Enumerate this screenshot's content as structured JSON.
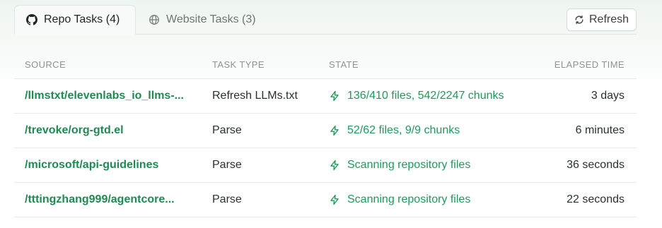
{
  "tabs": [
    {
      "label": "Repo Tasks (4)",
      "icon": "github-icon",
      "active": true
    },
    {
      "label": "Website Tasks (3)",
      "icon": "globe-icon",
      "active": false
    }
  ],
  "refresh": {
    "label": "Refresh",
    "icon": "refresh-icon"
  },
  "table": {
    "headers": {
      "source": "SOURCE",
      "task_type": "TASK TYPE",
      "state": "STATE",
      "elapsed": "ELAPSED TIME"
    },
    "rows": [
      {
        "source": "/llmstxt/elevenlabs_io_llms-...",
        "task_type": "Refresh LLMs.txt",
        "state": "136/410 files, 542/2247 chunks",
        "elapsed": "3 days"
      },
      {
        "source": "/trevoke/org-gtd.el",
        "task_type": "Parse",
        "state": "52/62 files, 9/9 chunks",
        "elapsed": "6 minutes"
      },
      {
        "source": "/microsoft/api-guidelines",
        "task_type": "Parse",
        "state": "Scanning repository files",
        "elapsed": "36 seconds"
      },
      {
        "source": "/tttingzhang999/agentcore...",
        "task_type": "Parse",
        "state": "Scanning repository files",
        "elapsed": "22 seconds"
      }
    ]
  },
  "colors": {
    "accent_green": "#1f9a5b",
    "link_green": "#1f8a52",
    "header_gray": "#8c9490"
  }
}
